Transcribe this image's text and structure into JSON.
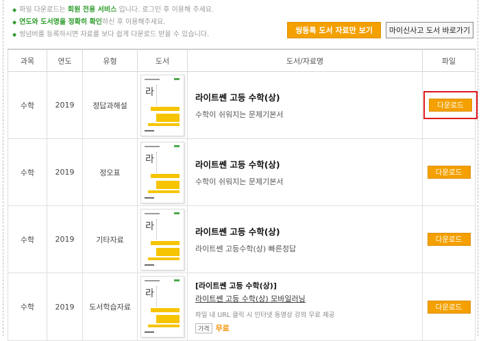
{
  "notices": [
    {
      "pre": "파일 다운로드는 ",
      "em": "회원 전용 서비스",
      "post": " 입니다. 로그인 후 이용해 주세요."
    },
    {
      "pre": "",
      "em": "연도와 도서명을 정확히 확인",
      "post": "하신 후 이용해주세요."
    },
    {
      "pre": "",
      "em": "",
      "post": "씽넘버를 등록하시면 자료를 보다 쉽게 다운로드 받을 수 있습니다."
    }
  ],
  "top_buttons": {
    "registered_only": "씽등록 도서 자료만 보기",
    "my_books": "마이신사고 도서 바로가기"
  },
  "table": {
    "headers": [
      "과목",
      "연도",
      "유형",
      "도서",
      "도서/자료명",
      "파일"
    ],
    "download_label": "다운로드",
    "rows": [
      {
        "subject": "수학",
        "year": "2019",
        "type": "정답과해설",
        "title": "라이트쎈 고등 수학(상)",
        "subtitle": "수학이 쉬워지는 문제기본서"
      },
      {
        "subject": "수학",
        "year": "2019",
        "type": "정오표",
        "title": "라이트쎈 고등 수학(상)",
        "subtitle": "수학이 쉬워지는 문제기본서"
      },
      {
        "subject": "수학",
        "year": "2019",
        "type": "기타자료",
        "title": "라이트쎈 고등 수학(상)",
        "subtitle": "라이트쎈 고등수학(상) 빠른정답"
      },
      {
        "subject": "수학",
        "year": "2019",
        "type": "도서학습자료",
        "title": "[라이트쎈 고등 수학(상)]",
        "link": "라이트쎈 고등 수학(상) 모바일러닝",
        "desc": "파일 내 URL 클릭 시 인터넷 동영상 강의 무료 제공",
        "price_tag": "가격",
        "price": "무료"
      }
    ]
  },
  "colors": {
    "accent_orange": "#f3a000",
    "notice_green": "#2a9a28",
    "highlight_red": "#e0151b"
  },
  "icons": {
    "bullet": "green-diamond-icon",
    "thumbnail": "book-cover-thumbnail"
  }
}
